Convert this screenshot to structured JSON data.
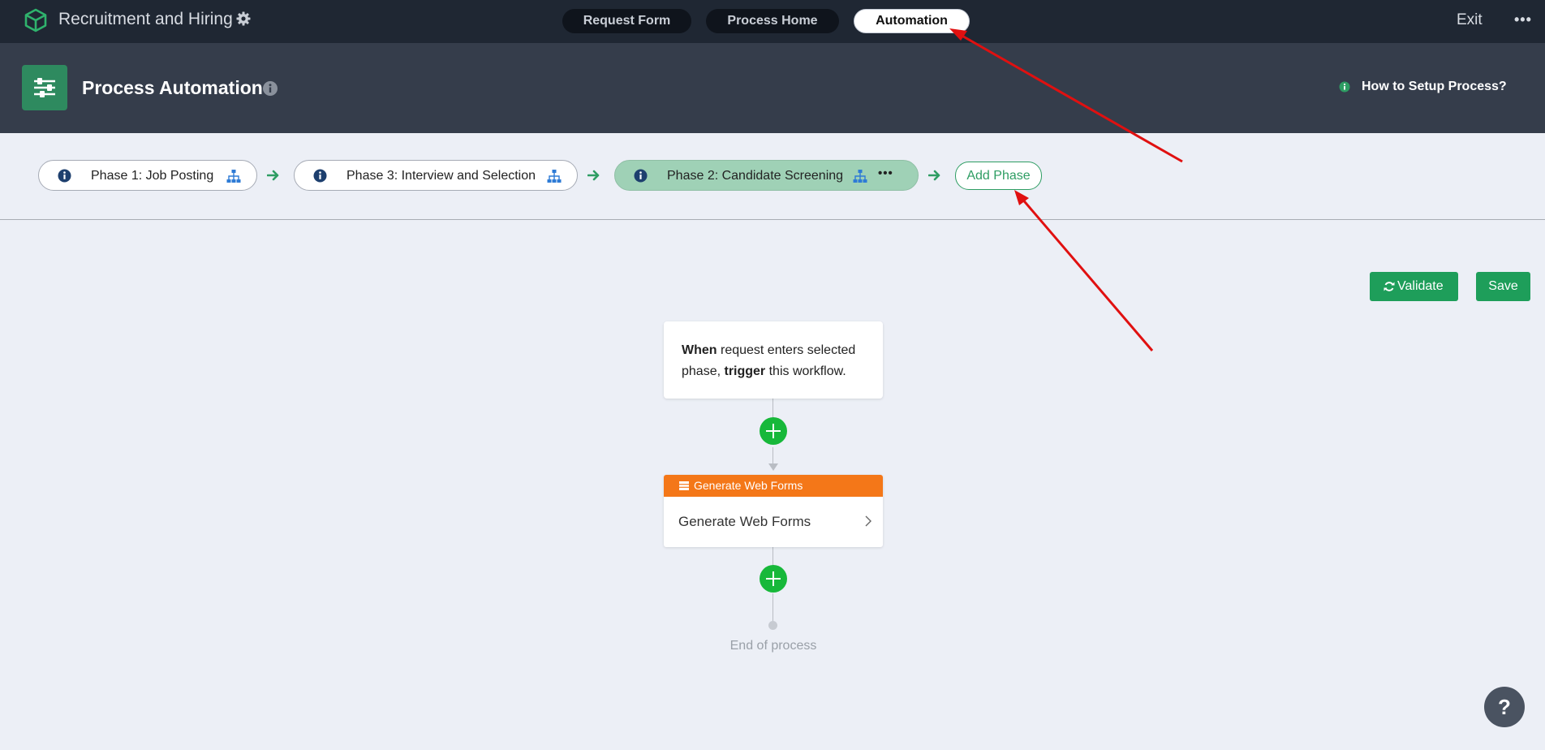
{
  "topbar": {
    "app_title": "Recruitment and Hiring",
    "tabs": [
      {
        "label": "Request Form",
        "active": false
      },
      {
        "label": "Process Home",
        "active": false
      },
      {
        "label": "Automation",
        "active": true
      }
    ],
    "exit_label": "Exit",
    "more_icon": "ellipsis-icon"
  },
  "header": {
    "title": "Process Automation",
    "help_link": "How to Setup Process?",
    "icon": "sliders-icon"
  },
  "phases": [
    {
      "label": "Phase 1: Job Posting",
      "active": false
    },
    {
      "label": "Phase 3: Interview and Selection",
      "active": false
    },
    {
      "label": "Phase 2: Candidate Screening",
      "active": true
    }
  ],
  "add_phase_label": "Add Phase",
  "actions": {
    "validate_label": "Validate",
    "save_label": "Save"
  },
  "workflow": {
    "trigger": {
      "when": "When",
      "text1": " request enters selected phase, ",
      "trigger_word": "trigger",
      "text2": " this workflow."
    },
    "action": {
      "header": "Generate Web Forms",
      "body": "Generate Web Forms"
    },
    "end_label": "End of process"
  },
  "help_button": "?",
  "colors": {
    "topbar": "#1f2733",
    "header": "#353d4b",
    "brand_green": "#1e9e5a",
    "active_phase": "#9fd1b6",
    "action_orange": "#f47718",
    "plus_green": "#17b83a",
    "annotation_red": "#e01010"
  }
}
